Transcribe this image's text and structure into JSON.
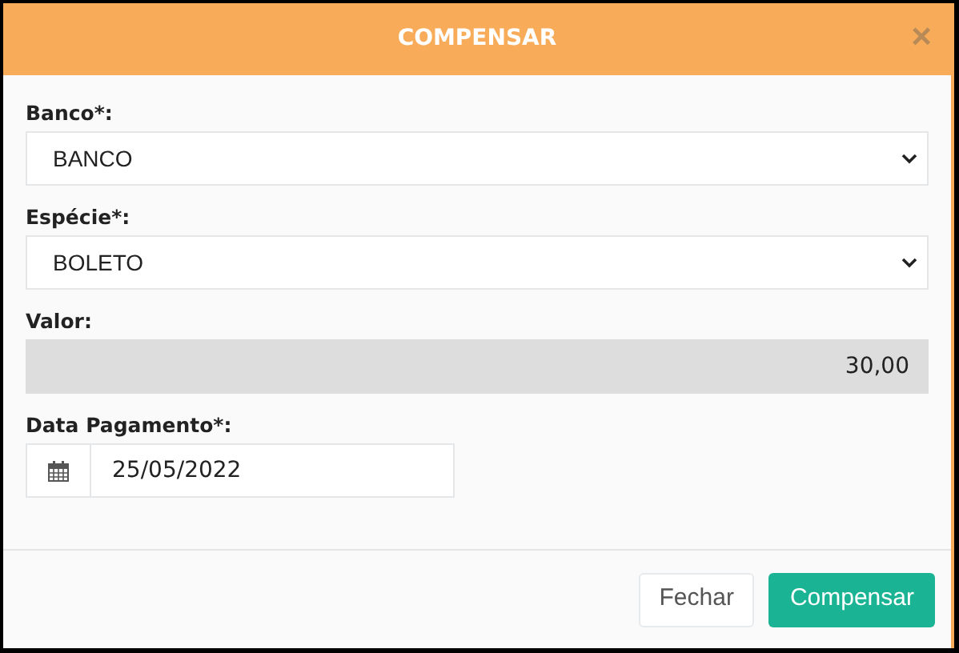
{
  "dialog": {
    "title": "COMPENSAR",
    "close": "×"
  },
  "fields": [
    {
      "kind": "select",
      "label": "Banco*:",
      "value": "BANCO"
    },
    {
      "kind": "select",
      "label": "Espécie*:",
      "value": "BOLETO"
    },
    {
      "kind": "readonly",
      "label": "Valor:",
      "value": "30,00"
    },
    {
      "kind": "date",
      "label": "Data Pagamento*:",
      "value": "25/05/2022"
    }
  ],
  "buttons": [
    {
      "kind": "default",
      "label": "Fechar"
    },
    {
      "kind": "primary",
      "label": "Compensar"
    }
  ]
}
